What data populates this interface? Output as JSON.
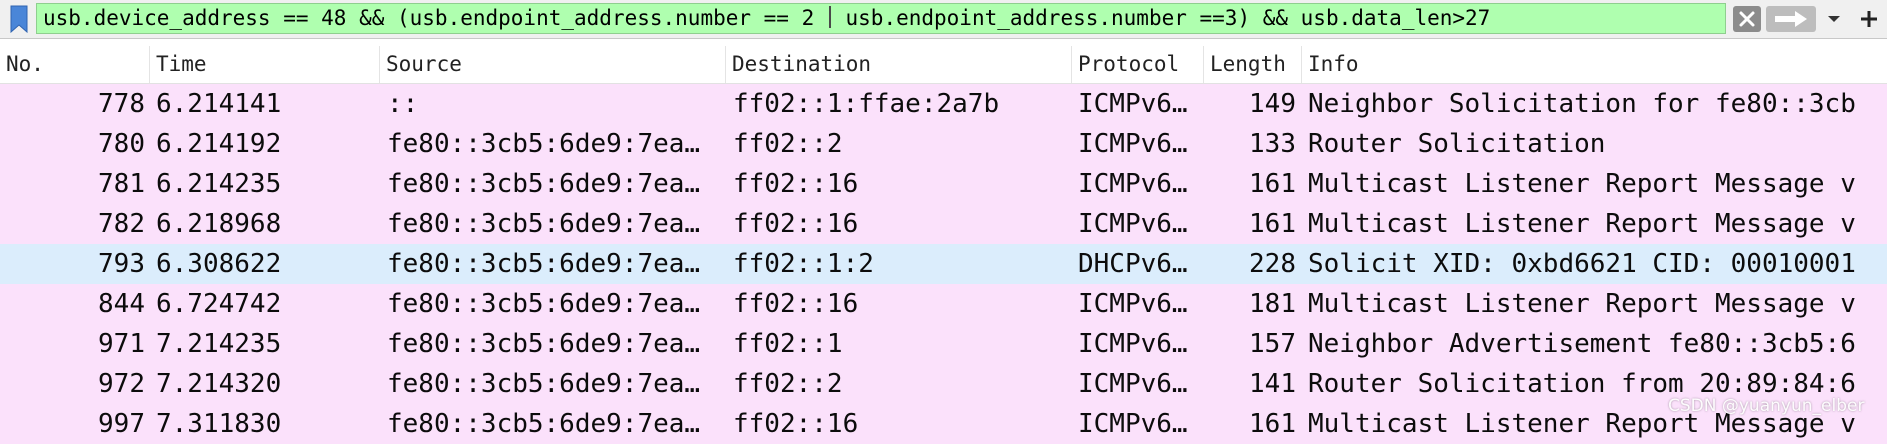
{
  "filter": {
    "expression_before_cursor": "usb.device_address == 48 && (usb.endpoint_address.number == 2 ",
    "expression_after_cursor": " usb.endpoint_address.number ==3) && usb.data_len>27",
    "background_color": "#afffaf"
  },
  "toolbar_icons": {
    "bookmark": "bookmark-icon",
    "clear": "close-icon",
    "apply": "arrow-right-icon",
    "dropdown": "chevron-down-icon",
    "add": "plus-icon"
  },
  "columns": {
    "no": "No.",
    "time": "Time",
    "source": "Source",
    "destination": "Destination",
    "protocol": "Protocol",
    "length": "Length",
    "info": "Info"
  },
  "rows": [
    {
      "no": "778",
      "time": "6.214141",
      "source": "::",
      "destination": "ff02::1:ffae:2a7b",
      "protocol": "ICMPv6…",
      "length": "149",
      "info": "Neighbor Solicitation for fe80::3cb",
      "color": "#fbe1fb"
    },
    {
      "no": "780",
      "time": "6.214192",
      "source": "fe80::3cb5:6de9:7ea…",
      "destination": "ff02::2",
      "protocol": "ICMPv6…",
      "length": "133",
      "info": "Router Solicitation",
      "color": "#fbe1fb"
    },
    {
      "no": "781",
      "time": "6.214235",
      "source": "fe80::3cb5:6de9:7ea…",
      "destination": "ff02::16",
      "protocol": "ICMPv6…",
      "length": "161",
      "info": "Multicast Listener Report Message v",
      "color": "#fbe1fb"
    },
    {
      "no": "782",
      "time": "6.218968",
      "source": "fe80::3cb5:6de9:7ea…",
      "destination": "ff02::16",
      "protocol": "ICMPv6…",
      "length": "161",
      "info": "Multicast Listener Report Message v",
      "color": "#fbe1fb"
    },
    {
      "no": "793",
      "time": "6.308622",
      "source": "fe80::3cb5:6de9:7ea…",
      "destination": "ff02::1:2",
      "protocol": "DHCPv6…",
      "length": "228",
      "info": "Solicit XID: 0xbd6621 CID: 00010001",
      "color": "#dbedfc"
    },
    {
      "no": "844",
      "time": "6.724742",
      "source": "fe80::3cb5:6de9:7ea…",
      "destination": "ff02::16",
      "protocol": "ICMPv6…",
      "length": "181",
      "info": "Multicast Listener Report Message v",
      "color": "#fbe1fb"
    },
    {
      "no": "971",
      "time": "7.214235",
      "source": "fe80::3cb5:6de9:7ea…",
      "destination": "ff02::1",
      "protocol": "ICMPv6…",
      "length": "157",
      "info": "Neighbor Advertisement fe80::3cb5:6",
      "color": "#fbe1fb"
    },
    {
      "no": "972",
      "time": "7.214320",
      "source": "fe80::3cb5:6de9:7ea…",
      "destination": "ff02::2",
      "protocol": "ICMPv6…",
      "length": "141",
      "info": "Router Solicitation from 20:89:84:6",
      "color": "#fbe1fb"
    },
    {
      "no": "997",
      "time": "7.311830",
      "source": "fe80::3cb5:6de9:7ea…",
      "destination": "ff02::16",
      "protocol": "ICMPv6…",
      "length": "161",
      "info": "Multicast Listener Report Message v",
      "color": "#fbe1fb"
    }
  ],
  "watermark": "CSDN @yuanyun_elber"
}
